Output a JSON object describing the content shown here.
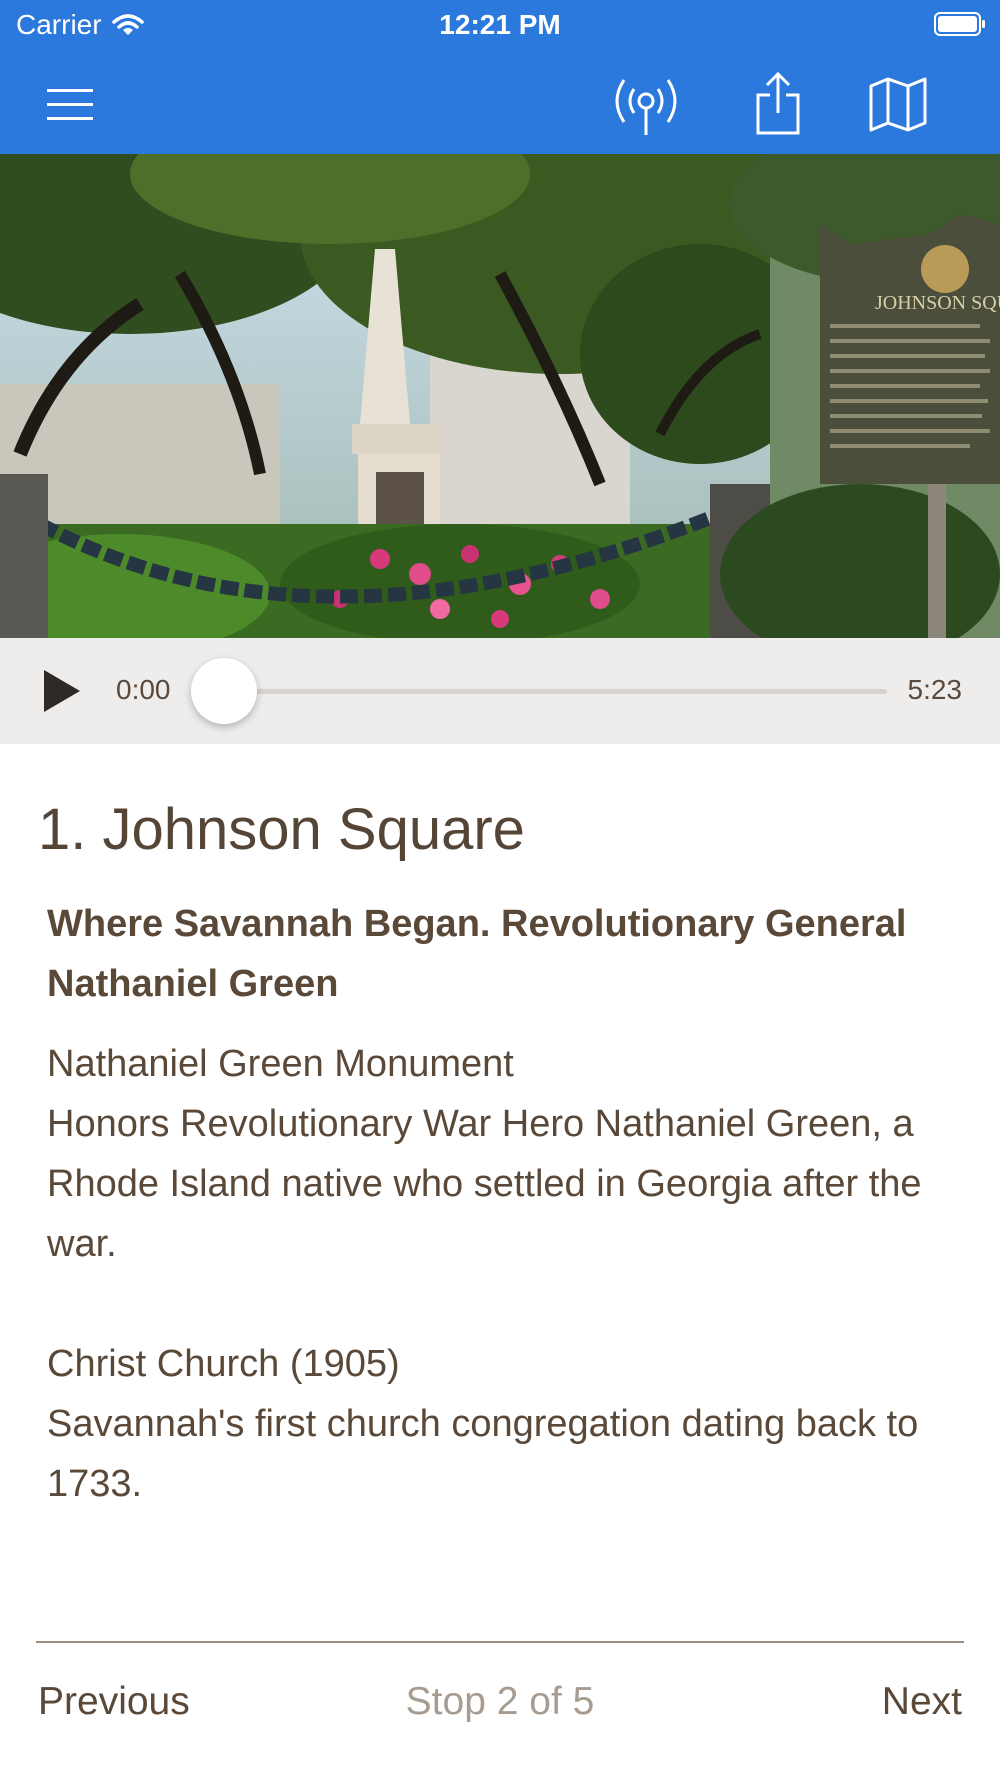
{
  "status_bar": {
    "carrier": "Carrier",
    "time": "12:21 PM"
  },
  "nav": {
    "icons": [
      "menu-icon",
      "broadcast-icon",
      "share-icon",
      "map-icon"
    ]
  },
  "player": {
    "current_time": "0:00",
    "duration": "5:23",
    "progress": 0.0
  },
  "stop": {
    "title": "1. Johnson Square",
    "subtitle": "Where Savannah Began. Revolutionary General Nathaniel Green",
    "paragraphs": [
      "Nathaniel Green Monument",
      "Honors Revolutionary War Hero Nathaniel Green, a Rhode Island native who settled in Georgia after the war.",
      "Christ Church (1905)",
      "Savannah's first church congregation dating back to 1733."
    ]
  },
  "hero": {
    "sign_text": "JOHNSON SQUARE"
  },
  "footer": {
    "previous": "Previous",
    "position": "Stop 2 of 5",
    "next": "Next"
  },
  "colors": {
    "accent": "#2b79dc",
    "text": "#5a4838",
    "muted": "#a79c91",
    "player_bg": "#efedeb"
  }
}
